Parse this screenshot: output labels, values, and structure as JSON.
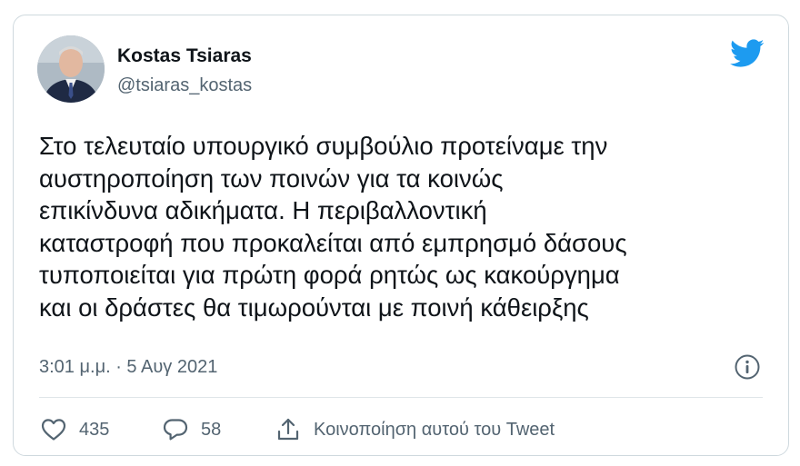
{
  "author": {
    "display_name": "Kostas Tsiaras",
    "handle": "@tsiaras_kostas",
    "avatar_icon": "profile-photo"
  },
  "tweet": {
    "lines": [
      "Στο τελευταίο υπουργικό συμβούλιο προτείναμε την",
      "αυστηροποίηση των ποινών για τα κοινώς",
      "επικίνδυνα αδικήματα. Η περιβαλλοντική",
      "καταστροφή που προκαλείται από εμπρησμό δάσους",
      "τυποποιείται για πρώτη φορά ρητώς ως κακούργημα",
      "και οι δράστες θα τιμωρούνται με ποινή κάθειρξης"
    ],
    "timestamp": "3:01 μ.μ. · 5 Αυγ 2021"
  },
  "actions": {
    "like_count": "435",
    "reply_count": "58",
    "share_label": "Κοινοποίηση αυτού του Tweet"
  },
  "colors": {
    "brand": "#1d9bf0",
    "text": "#0f1419",
    "secondary": "#536471",
    "border": "#cfd9de"
  }
}
